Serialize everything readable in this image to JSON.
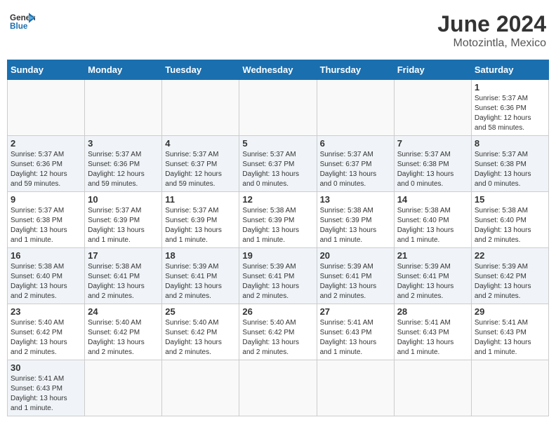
{
  "header": {
    "logo_general": "General",
    "logo_blue": "Blue",
    "month_year": "June 2024",
    "location": "Motozintla, Mexico"
  },
  "weekdays": [
    "Sunday",
    "Monday",
    "Tuesday",
    "Wednesday",
    "Thursday",
    "Friday",
    "Saturday"
  ],
  "weeks": [
    {
      "days": [
        {
          "num": "",
          "info": ""
        },
        {
          "num": "",
          "info": ""
        },
        {
          "num": "",
          "info": ""
        },
        {
          "num": "",
          "info": ""
        },
        {
          "num": "",
          "info": ""
        },
        {
          "num": "",
          "info": ""
        },
        {
          "num": "1",
          "info": "Sunrise: 5:37 AM\nSunset: 6:36 PM\nDaylight: 12 hours\nand 58 minutes."
        }
      ]
    },
    {
      "days": [
        {
          "num": "2",
          "info": "Sunrise: 5:37 AM\nSunset: 6:36 PM\nDaylight: 12 hours\nand 59 minutes."
        },
        {
          "num": "3",
          "info": "Sunrise: 5:37 AM\nSunset: 6:36 PM\nDaylight: 12 hours\nand 59 minutes."
        },
        {
          "num": "4",
          "info": "Sunrise: 5:37 AM\nSunset: 6:37 PM\nDaylight: 12 hours\nand 59 minutes."
        },
        {
          "num": "5",
          "info": "Sunrise: 5:37 AM\nSunset: 6:37 PM\nDaylight: 13 hours\nand 0 minutes."
        },
        {
          "num": "6",
          "info": "Sunrise: 5:37 AM\nSunset: 6:37 PM\nDaylight: 13 hours\nand 0 minutes."
        },
        {
          "num": "7",
          "info": "Sunrise: 5:37 AM\nSunset: 6:38 PM\nDaylight: 13 hours\nand 0 minutes."
        },
        {
          "num": "8",
          "info": "Sunrise: 5:37 AM\nSunset: 6:38 PM\nDaylight: 13 hours\nand 0 minutes."
        }
      ]
    },
    {
      "days": [
        {
          "num": "9",
          "info": "Sunrise: 5:37 AM\nSunset: 6:38 PM\nDaylight: 13 hours\nand 1 minute."
        },
        {
          "num": "10",
          "info": "Sunrise: 5:37 AM\nSunset: 6:39 PM\nDaylight: 13 hours\nand 1 minute."
        },
        {
          "num": "11",
          "info": "Sunrise: 5:37 AM\nSunset: 6:39 PM\nDaylight: 13 hours\nand 1 minute."
        },
        {
          "num": "12",
          "info": "Sunrise: 5:38 AM\nSunset: 6:39 PM\nDaylight: 13 hours\nand 1 minute."
        },
        {
          "num": "13",
          "info": "Sunrise: 5:38 AM\nSunset: 6:39 PM\nDaylight: 13 hours\nand 1 minute."
        },
        {
          "num": "14",
          "info": "Sunrise: 5:38 AM\nSunset: 6:40 PM\nDaylight: 13 hours\nand 1 minute."
        },
        {
          "num": "15",
          "info": "Sunrise: 5:38 AM\nSunset: 6:40 PM\nDaylight: 13 hours\nand 2 minutes."
        }
      ]
    },
    {
      "days": [
        {
          "num": "16",
          "info": "Sunrise: 5:38 AM\nSunset: 6:40 PM\nDaylight: 13 hours\nand 2 minutes."
        },
        {
          "num": "17",
          "info": "Sunrise: 5:38 AM\nSunset: 6:41 PM\nDaylight: 13 hours\nand 2 minutes."
        },
        {
          "num": "18",
          "info": "Sunrise: 5:39 AM\nSunset: 6:41 PM\nDaylight: 13 hours\nand 2 minutes."
        },
        {
          "num": "19",
          "info": "Sunrise: 5:39 AM\nSunset: 6:41 PM\nDaylight: 13 hours\nand 2 minutes."
        },
        {
          "num": "20",
          "info": "Sunrise: 5:39 AM\nSunset: 6:41 PM\nDaylight: 13 hours\nand 2 minutes."
        },
        {
          "num": "21",
          "info": "Sunrise: 5:39 AM\nSunset: 6:41 PM\nDaylight: 13 hours\nand 2 minutes."
        },
        {
          "num": "22",
          "info": "Sunrise: 5:39 AM\nSunset: 6:42 PM\nDaylight: 13 hours\nand 2 minutes."
        }
      ]
    },
    {
      "days": [
        {
          "num": "23",
          "info": "Sunrise: 5:40 AM\nSunset: 6:42 PM\nDaylight: 13 hours\nand 2 minutes."
        },
        {
          "num": "24",
          "info": "Sunrise: 5:40 AM\nSunset: 6:42 PM\nDaylight: 13 hours\nand 2 minutes."
        },
        {
          "num": "25",
          "info": "Sunrise: 5:40 AM\nSunset: 6:42 PM\nDaylight: 13 hours\nand 2 minutes."
        },
        {
          "num": "26",
          "info": "Sunrise: 5:40 AM\nSunset: 6:42 PM\nDaylight: 13 hours\nand 2 minutes."
        },
        {
          "num": "27",
          "info": "Sunrise: 5:41 AM\nSunset: 6:43 PM\nDaylight: 13 hours\nand 1 minute."
        },
        {
          "num": "28",
          "info": "Sunrise: 5:41 AM\nSunset: 6:43 PM\nDaylight: 13 hours\nand 1 minute."
        },
        {
          "num": "29",
          "info": "Sunrise: 5:41 AM\nSunset: 6:43 PM\nDaylight: 13 hours\nand 1 minute."
        }
      ]
    },
    {
      "days": [
        {
          "num": "30",
          "info": "Sunrise: 5:41 AM\nSunset: 6:43 PM\nDaylight: 13 hours\nand 1 minute."
        },
        {
          "num": "",
          "info": ""
        },
        {
          "num": "",
          "info": ""
        },
        {
          "num": "",
          "info": ""
        },
        {
          "num": "",
          "info": ""
        },
        {
          "num": "",
          "info": ""
        },
        {
          "num": "",
          "info": ""
        }
      ]
    }
  ]
}
